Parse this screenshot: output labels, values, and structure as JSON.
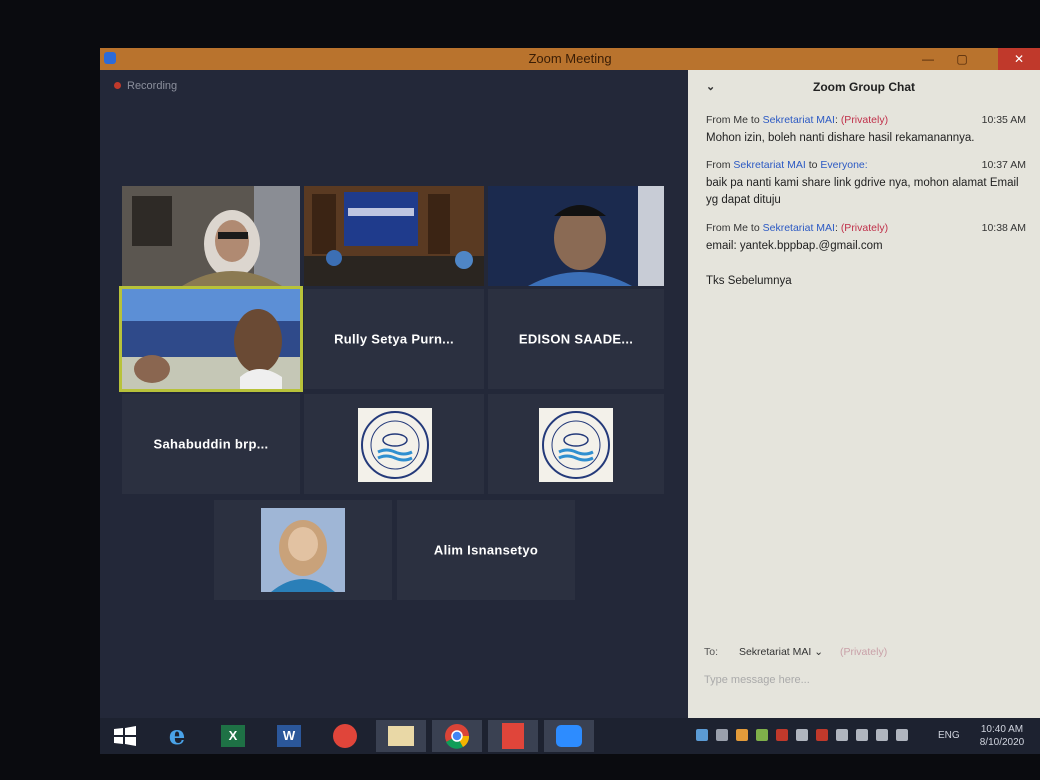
{
  "window": {
    "title": "Zoom Meeting",
    "close_label": "✕",
    "minimize_label": "—",
    "maximize_label": "▢"
  },
  "recording": {
    "label": "Recording"
  },
  "participants": [
    {
      "name": "Rully  Setya  Purn..."
    },
    {
      "name": "EDISON  SAADE..."
    },
    {
      "name": "Sahabuddin  brp..."
    },
    {
      "name": "Alim Isnansetyo"
    }
  ],
  "chat": {
    "title": "Zoom Group Chat",
    "messages": [
      {
        "from": "From Me",
        "to_word": "to",
        "to": "Sekretariat MAI",
        "privacy": "(Privately)",
        "time": "10:35 AM",
        "text": "Mohon izin, boleh nanti dishare hasil rekamanannya."
      },
      {
        "from": "From",
        "from_name": "Sekretariat MAI",
        "to_word": "to",
        "to": "Everyone:",
        "time": "10:37 AM",
        "text": "baik pa nanti kami share link gdrive nya, mohon alamat Email yg dapat dituju"
      },
      {
        "from": "From Me",
        "to_word": "to",
        "to": "Sekretariat MAI",
        "privacy": "(Privately)",
        "time": "10:38 AM",
        "text": "email: yantek.bppbap.@gmail.com",
        "text2": "Tks Sebelumnya"
      }
    ],
    "to_label": "To:",
    "to_value": "Sekretariat MAI",
    "to_privacy": "(Privately)",
    "input_placeholder": "Type message here..."
  },
  "taskbar": {
    "lang": "ENG",
    "time": "10:40 AM",
    "date": "8/10/2020",
    "apps": [
      "windows-start",
      "internet-explorer",
      "excel",
      "word",
      "app-red",
      "file-explorer",
      "chrome",
      "acrobat",
      "zoom"
    ]
  },
  "colors": {
    "accent_active": "#b8c23a",
    "titlebar": "#b9732d",
    "link_blue": "#2b59c3",
    "private_red": "#c0304a"
  }
}
